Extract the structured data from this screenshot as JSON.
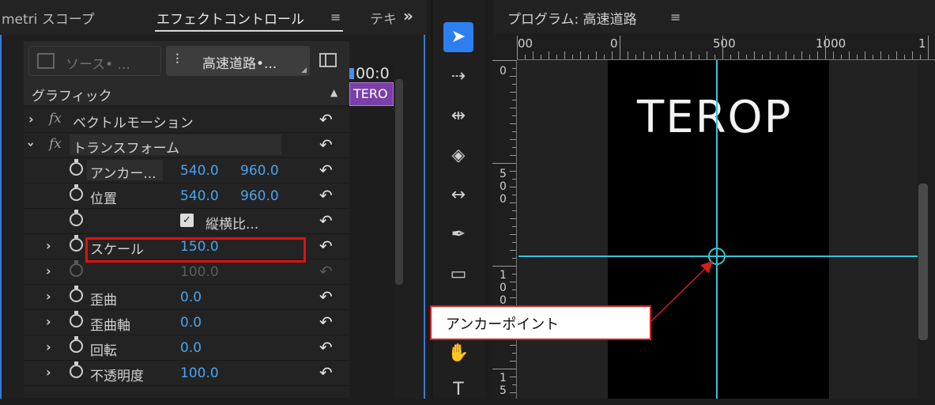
{
  "left_panel": {
    "tabs": {
      "lumetri": "metri スコープ",
      "effect_controls": "エフェクトコントロール",
      "menu_icon": "≡",
      "text": "テキ",
      "overflow": "»"
    },
    "source_button": "ソース• ...",
    "sequence_button": "高速道路•...",
    "section_header": "グラフィック",
    "rows": [
      {
        "name": "ベクトルモーション"
      },
      {
        "name": "トランスフォーム"
      },
      {
        "name": "アンカー...",
        "v1": "540.0",
        "v2": "960.0"
      },
      {
        "name": "位置",
        "v1": "540.0",
        "v2": "960.0"
      },
      {
        "name": "",
        "checkbox_label": "縦横比..."
      },
      {
        "name": "スケール",
        "v1": "150.0"
      },
      {
        "name": "",
        "v1": "100.0"
      },
      {
        "name": "歪曲",
        "v1": "0.0"
      },
      {
        "name": "歪曲軸",
        "v1": "0.0"
      },
      {
        "name": "回転",
        "v1": "0.0"
      },
      {
        "name": "不透明度",
        "v1": "100.0"
      }
    ],
    "timeline": {
      "time": "00:0",
      "clip_label": "TERO"
    }
  },
  "program": {
    "title": "プログラム: 高速道路",
    "menu_icon": "≡",
    "ruler_h": [
      "00",
      "0",
      "500",
      "1000",
      "1"
    ],
    "ruler_v": [
      [
        "0"
      ],
      [
        "5",
        "0",
        "0"
      ],
      [
        "1",
        "0",
        "0"
      ],
      [
        "1",
        "5"
      ]
    ],
    "terop_text": "TEROP",
    "callout": "アンカーポイント"
  },
  "colors": {
    "accent_blue": "#2d7ff0",
    "value_blue": "#4aa3ee",
    "guide_cyan": "#35c4d8",
    "highlight_red": "#e01010",
    "clip_purple": "#7a3fa8"
  }
}
